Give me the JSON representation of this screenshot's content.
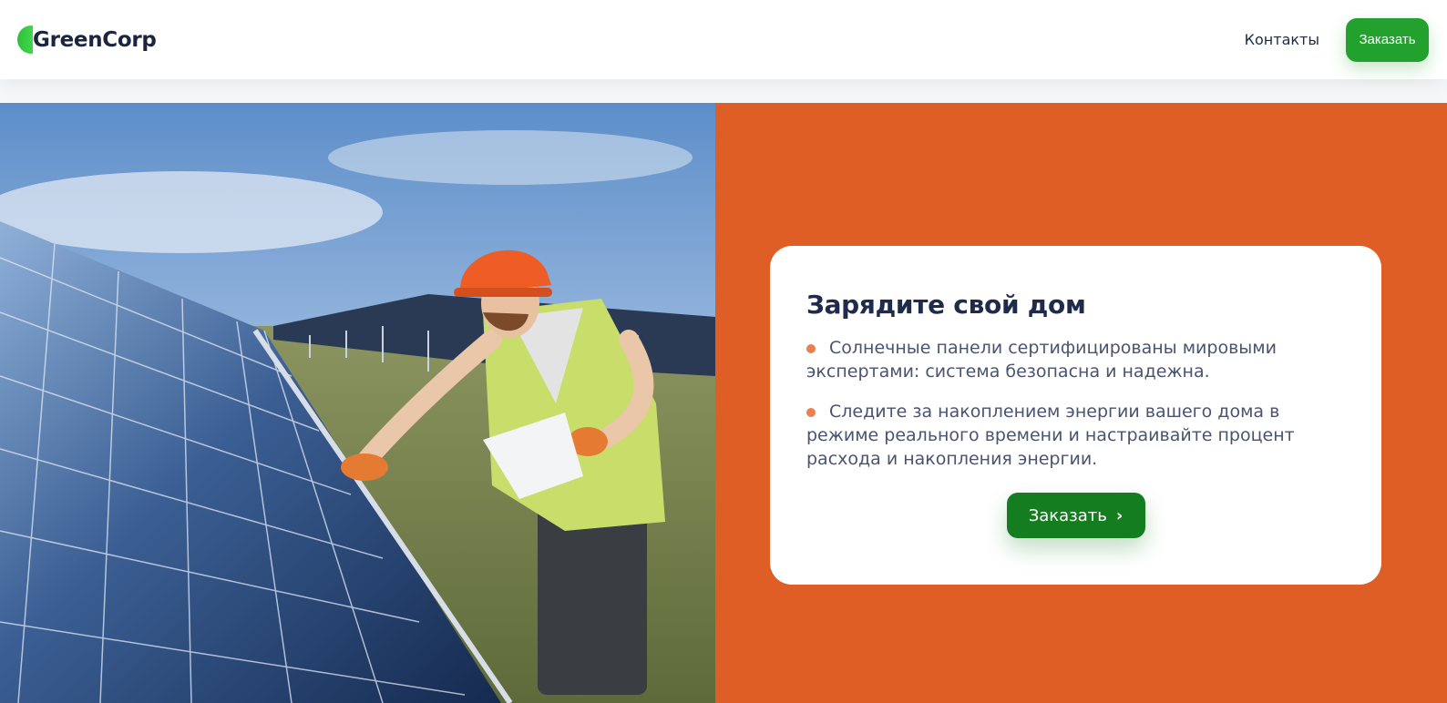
{
  "header": {
    "logo_text": "GreenCorp",
    "nav_contacts": "Контакты",
    "order_button": "Заказать"
  },
  "hero": {
    "image_icon": "solar-worker-photo",
    "card": {
      "title": "Зарядите свой дом",
      "bullets": [
        "Солнечные панели сертифицированы мировыми экспертами: система безопасна и надежна.",
        "Следите за накоплением энергии вашего дома в режиме реального времени и настраивайте процент расхода и накопления энергии."
      ],
      "cta_label": "Заказать",
      "cta_icon": "chevron-right-icon"
    }
  },
  "colors": {
    "brand_green": "#23a12f",
    "cta_green": "#147d1f",
    "accent_orange": "#df5e26",
    "bullet_orange": "#e8814f",
    "title_navy": "#1f2b4b"
  }
}
